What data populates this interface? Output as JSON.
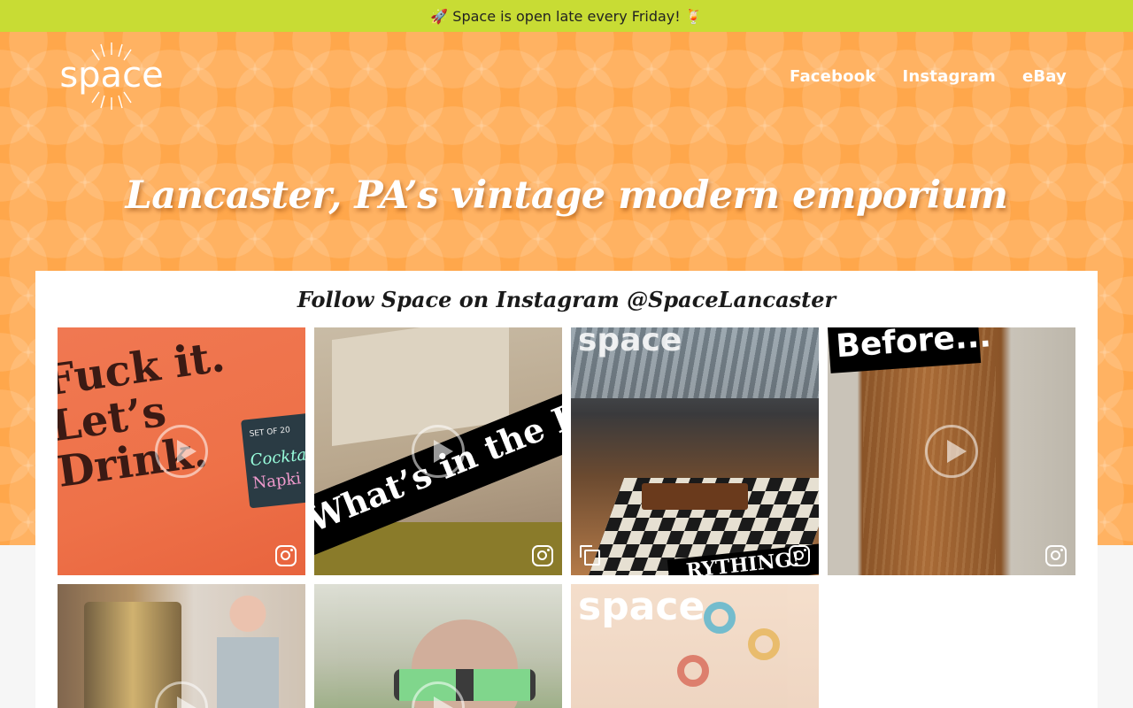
{
  "announcement": {
    "text": "🚀 Space is open late every Friday! 🍹"
  },
  "brand": {
    "logo_text": "space"
  },
  "nav": {
    "items": [
      "Facebook",
      "Instagram",
      "eBay"
    ]
  },
  "hero": {
    "tagline": "Lancaster, PA’s vintage modern emporium"
  },
  "instagram": {
    "title": "Follow Space on Instagram @SpaceLancaster",
    "posts": [
      {
        "type": "video",
        "text_lines": [
          "Fuck it.",
          "Let’s",
          "Drink."
        ],
        "card": {
          "top": "SET OF 20",
          "word1": "Cocktail",
          "word2": "Napki"
        }
      },
      {
        "type": "video",
        "banner": "What’s in the BOX?!?"
      },
      {
        "type": "carousel",
        "logo_text": "space",
        "banner": "RYTHING!"
      },
      {
        "type": "video",
        "banner": "Before..."
      },
      {
        "type": "video"
      },
      {
        "type": "video"
      },
      {
        "type": "image",
        "logo_text": "space"
      }
    ]
  },
  "colors": {
    "announce_bg": "#c8dc34",
    "hero_bg": "#ffa74b",
    "panel_bg": "#ffffff"
  }
}
